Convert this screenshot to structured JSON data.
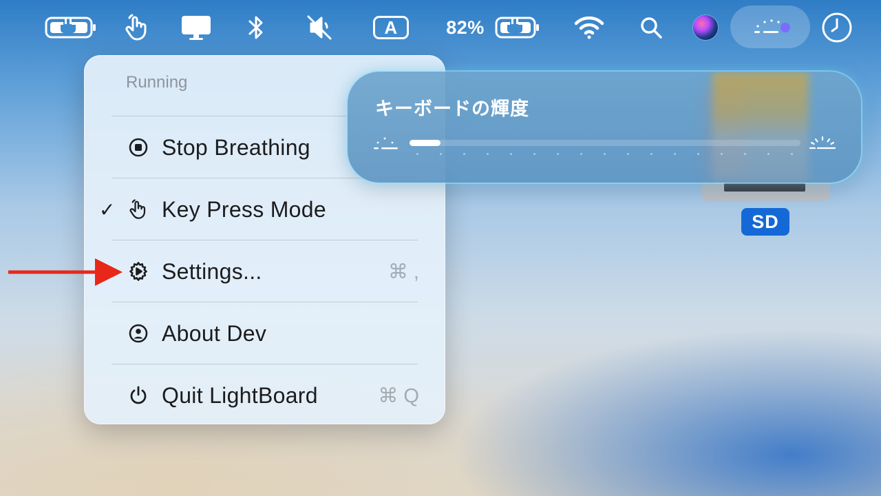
{
  "menubar": {
    "battery_percent": "82%",
    "input_source": "A"
  },
  "menu": {
    "header": "Running",
    "items": [
      {
        "label": "Stop Breathing",
        "shortcut": "",
        "checked": false,
        "icon": "stop-circle-icon"
      },
      {
        "label": "Key Press Mode",
        "shortcut": "",
        "checked": true,
        "check_mark": "✓",
        "icon": "tap-hand-icon"
      },
      {
        "label": "Settings...",
        "shortcut": "⌘ ,",
        "checked": false,
        "icon": "gear-icon"
      },
      {
        "label": "About Dev",
        "shortcut": "",
        "checked": false,
        "icon": "person-circle-icon"
      },
      {
        "label": "Quit LightBoard",
        "shortcut": "⌘ Q",
        "checked": false,
        "icon": "power-icon"
      }
    ]
  },
  "hud": {
    "title": "キーボードの輝度",
    "brightness_fraction": 0.08
  },
  "disk": {
    "label": "SD"
  },
  "colors": {
    "arrow": "#e8271b",
    "disk_label_bg": "#1469d6",
    "hud_bg": "#6ea5cd",
    "menu_bg": "#e4f0fa"
  }
}
